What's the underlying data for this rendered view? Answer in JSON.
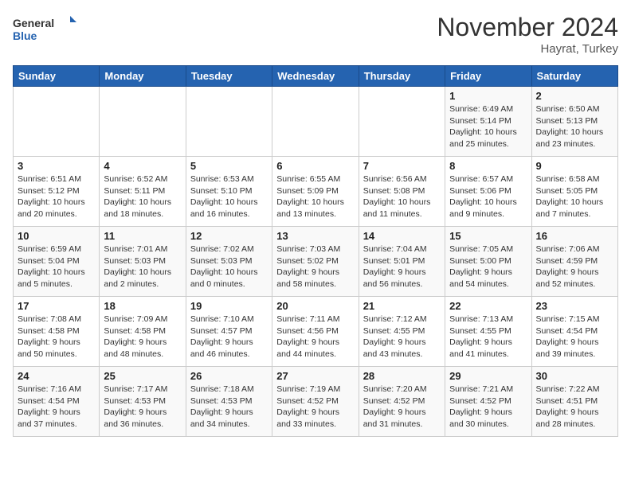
{
  "header": {
    "logo_general": "General",
    "logo_blue": "Blue",
    "month_title": "November 2024",
    "subtitle": "Hayrat, Turkey"
  },
  "weekdays": [
    "Sunday",
    "Monday",
    "Tuesday",
    "Wednesday",
    "Thursday",
    "Friday",
    "Saturday"
  ],
  "weeks": [
    [
      {
        "day": "",
        "info": ""
      },
      {
        "day": "",
        "info": ""
      },
      {
        "day": "",
        "info": ""
      },
      {
        "day": "",
        "info": ""
      },
      {
        "day": "",
        "info": ""
      },
      {
        "day": "1",
        "info": "Sunrise: 6:49 AM\nSunset: 5:14 PM\nDaylight: 10 hours\nand 25 minutes."
      },
      {
        "day": "2",
        "info": "Sunrise: 6:50 AM\nSunset: 5:13 PM\nDaylight: 10 hours\nand 23 minutes."
      }
    ],
    [
      {
        "day": "3",
        "info": "Sunrise: 6:51 AM\nSunset: 5:12 PM\nDaylight: 10 hours\nand 20 minutes."
      },
      {
        "day": "4",
        "info": "Sunrise: 6:52 AM\nSunset: 5:11 PM\nDaylight: 10 hours\nand 18 minutes."
      },
      {
        "day": "5",
        "info": "Sunrise: 6:53 AM\nSunset: 5:10 PM\nDaylight: 10 hours\nand 16 minutes."
      },
      {
        "day": "6",
        "info": "Sunrise: 6:55 AM\nSunset: 5:09 PM\nDaylight: 10 hours\nand 13 minutes."
      },
      {
        "day": "7",
        "info": "Sunrise: 6:56 AM\nSunset: 5:08 PM\nDaylight: 10 hours\nand 11 minutes."
      },
      {
        "day": "8",
        "info": "Sunrise: 6:57 AM\nSunset: 5:06 PM\nDaylight: 10 hours\nand 9 minutes."
      },
      {
        "day": "9",
        "info": "Sunrise: 6:58 AM\nSunset: 5:05 PM\nDaylight: 10 hours\nand 7 minutes."
      }
    ],
    [
      {
        "day": "10",
        "info": "Sunrise: 6:59 AM\nSunset: 5:04 PM\nDaylight: 10 hours\nand 5 minutes."
      },
      {
        "day": "11",
        "info": "Sunrise: 7:01 AM\nSunset: 5:03 PM\nDaylight: 10 hours\nand 2 minutes."
      },
      {
        "day": "12",
        "info": "Sunrise: 7:02 AM\nSunset: 5:03 PM\nDaylight: 10 hours\nand 0 minutes."
      },
      {
        "day": "13",
        "info": "Sunrise: 7:03 AM\nSunset: 5:02 PM\nDaylight: 9 hours\nand 58 minutes."
      },
      {
        "day": "14",
        "info": "Sunrise: 7:04 AM\nSunset: 5:01 PM\nDaylight: 9 hours\nand 56 minutes."
      },
      {
        "day": "15",
        "info": "Sunrise: 7:05 AM\nSunset: 5:00 PM\nDaylight: 9 hours\nand 54 minutes."
      },
      {
        "day": "16",
        "info": "Sunrise: 7:06 AM\nSunset: 4:59 PM\nDaylight: 9 hours\nand 52 minutes."
      }
    ],
    [
      {
        "day": "17",
        "info": "Sunrise: 7:08 AM\nSunset: 4:58 PM\nDaylight: 9 hours\nand 50 minutes."
      },
      {
        "day": "18",
        "info": "Sunrise: 7:09 AM\nSunset: 4:58 PM\nDaylight: 9 hours\nand 48 minutes."
      },
      {
        "day": "19",
        "info": "Sunrise: 7:10 AM\nSunset: 4:57 PM\nDaylight: 9 hours\nand 46 minutes."
      },
      {
        "day": "20",
        "info": "Sunrise: 7:11 AM\nSunset: 4:56 PM\nDaylight: 9 hours\nand 44 minutes."
      },
      {
        "day": "21",
        "info": "Sunrise: 7:12 AM\nSunset: 4:55 PM\nDaylight: 9 hours\nand 43 minutes."
      },
      {
        "day": "22",
        "info": "Sunrise: 7:13 AM\nSunset: 4:55 PM\nDaylight: 9 hours\nand 41 minutes."
      },
      {
        "day": "23",
        "info": "Sunrise: 7:15 AM\nSunset: 4:54 PM\nDaylight: 9 hours\nand 39 minutes."
      }
    ],
    [
      {
        "day": "24",
        "info": "Sunrise: 7:16 AM\nSunset: 4:54 PM\nDaylight: 9 hours\nand 37 minutes."
      },
      {
        "day": "25",
        "info": "Sunrise: 7:17 AM\nSunset: 4:53 PM\nDaylight: 9 hours\nand 36 minutes."
      },
      {
        "day": "26",
        "info": "Sunrise: 7:18 AM\nSunset: 4:53 PM\nDaylight: 9 hours\nand 34 minutes."
      },
      {
        "day": "27",
        "info": "Sunrise: 7:19 AM\nSunset: 4:52 PM\nDaylight: 9 hours\nand 33 minutes."
      },
      {
        "day": "28",
        "info": "Sunrise: 7:20 AM\nSunset: 4:52 PM\nDaylight: 9 hours\nand 31 minutes."
      },
      {
        "day": "29",
        "info": "Sunrise: 7:21 AM\nSunset: 4:52 PM\nDaylight: 9 hours\nand 30 minutes."
      },
      {
        "day": "30",
        "info": "Sunrise: 7:22 AM\nSunset: 4:51 PM\nDaylight: 9 hours\nand 28 minutes."
      }
    ]
  ]
}
